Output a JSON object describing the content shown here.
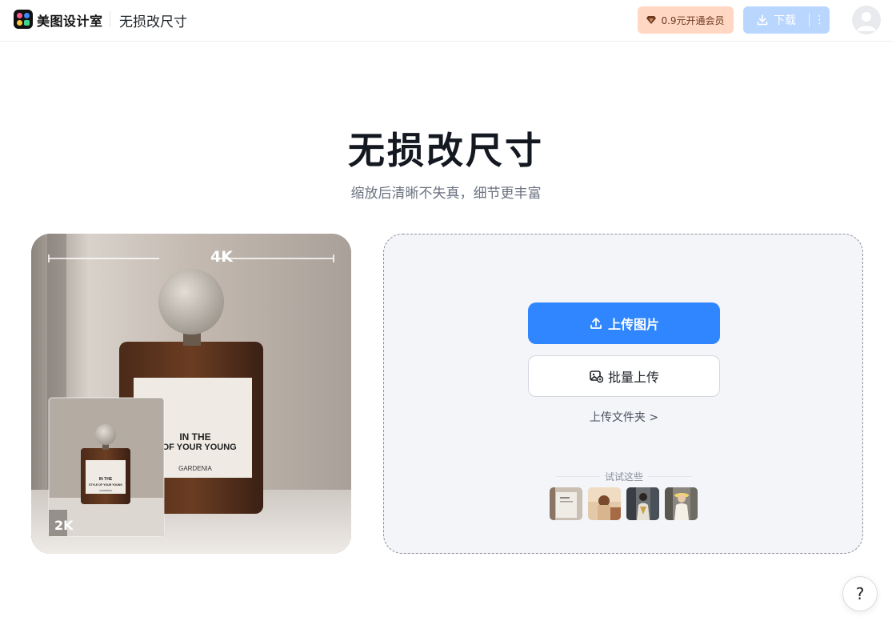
{
  "header": {
    "brand": "美图设计室",
    "tool_title": "无损改尺寸",
    "vip_button": "0.9元开通会员",
    "download_button": "下载",
    "more_icon": "⋮"
  },
  "hero": {
    "title": "无损改尺寸",
    "subtitle": "缩放后清晰不失真，细节更丰富"
  },
  "preview": {
    "large_label": "4K",
    "small_label": "2K",
    "bottle_label_large": [
      "IN THE",
      "E  OF YOUR YOUNG",
      "GARDENIA"
    ],
    "bottle_label_small": [
      "IN THE",
      "STYLE OF YOUR YOUNG",
      "GARDENIA"
    ]
  },
  "upload": {
    "upload_button": "上传图片",
    "batch_button": "批量上传",
    "folder_link": "上传文件夹 >",
    "try_label": "试试这些",
    "samples": [
      "sample-1",
      "sample-2",
      "sample-3",
      "sample-4"
    ]
  },
  "help": {
    "label": "?"
  },
  "colors": {
    "primary": "#2f86ff",
    "download_disabled": "#b9d6ff",
    "vip_bg": "#ffd7c2",
    "panel_bg": "#f4f5f9"
  }
}
